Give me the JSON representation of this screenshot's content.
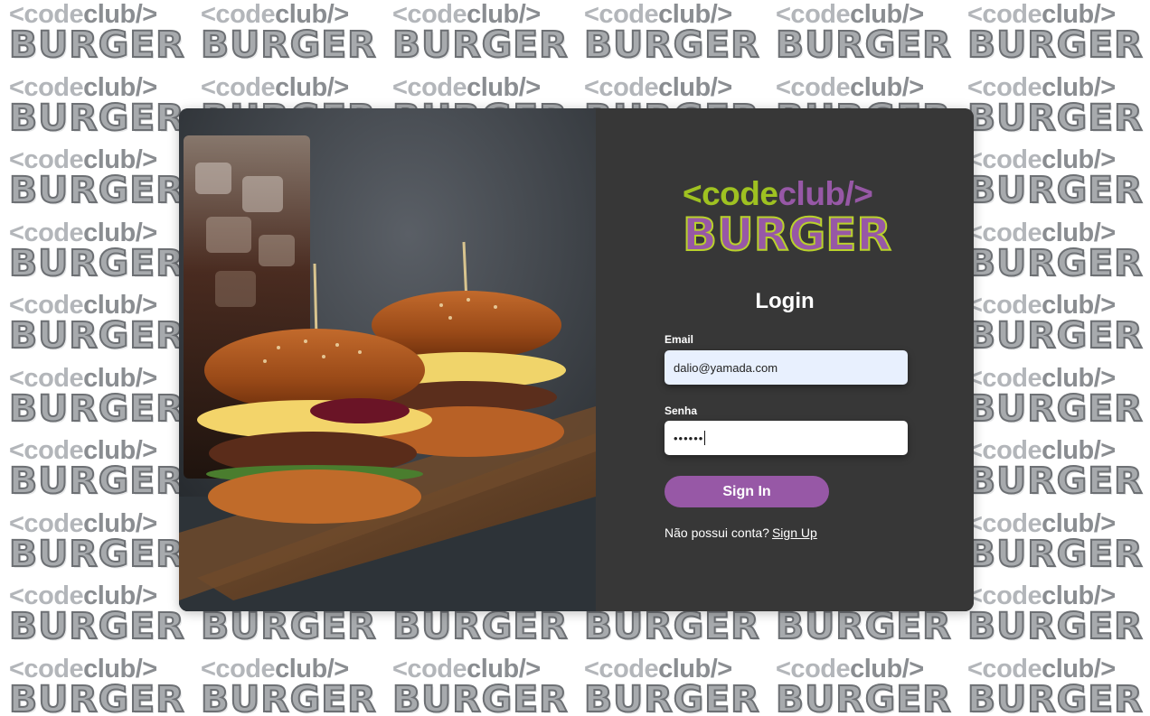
{
  "background": {
    "logo_line1_light": "<code",
    "logo_line1_dark": "club/>",
    "logo_line2": "BURGER"
  },
  "photo": {
    "icon": "burger-photo"
  },
  "brand": {
    "line1_part1": "<code",
    "line1_part2": "club/>",
    "line2": "BURGER",
    "colors": {
      "green": "#9fc221",
      "purple": "#9758a6"
    }
  },
  "form": {
    "title": "Login",
    "email_label": "Email",
    "email_value": "dalio@yamada.com",
    "password_label": "Senha",
    "password_value": "••••••",
    "submit_label": "Sign In",
    "signup_prompt": "Não possui conta?",
    "signup_link": "Sign Up"
  },
  "colors": {
    "card_bg": "#373737",
    "accent": "#9758a6",
    "email_field_bg": "#e8f0fe"
  }
}
